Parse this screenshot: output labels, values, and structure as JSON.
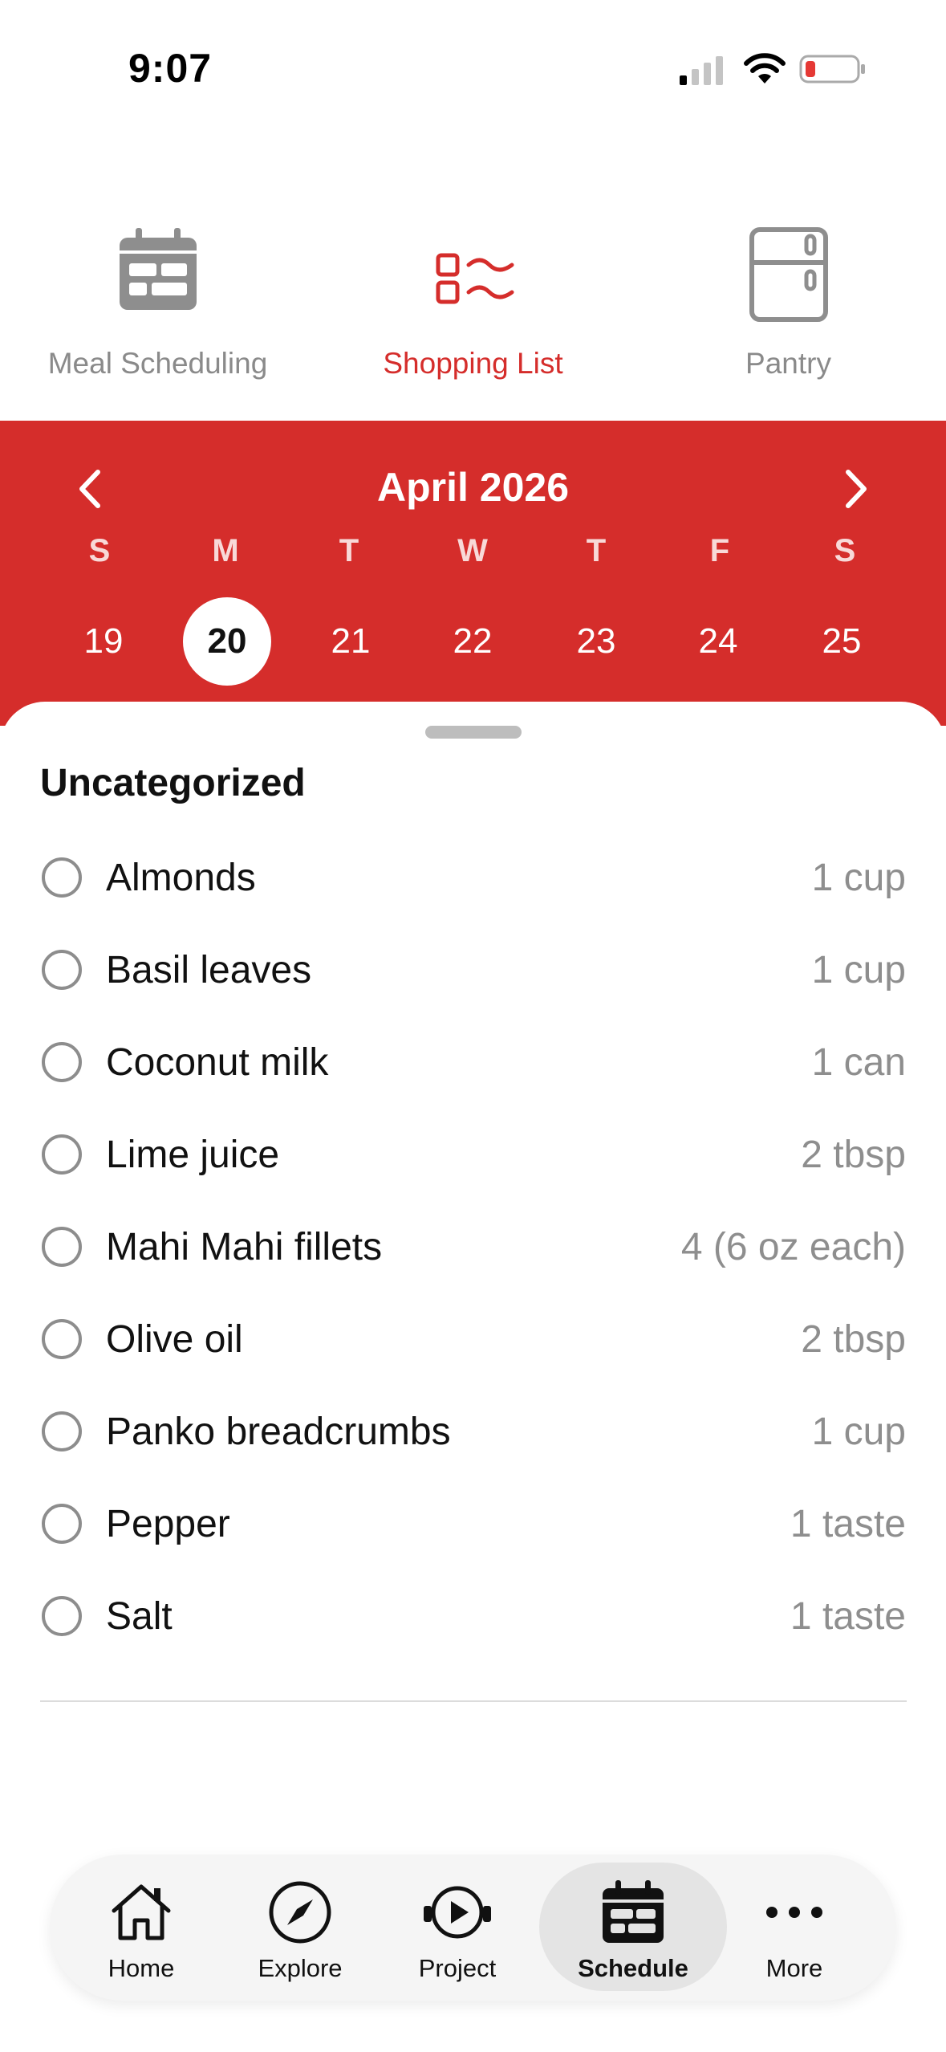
{
  "status_bar": {
    "time": "9:07"
  },
  "top_tabs": [
    {
      "label": "Meal Scheduling",
      "icon": "calendar-icon",
      "active": false
    },
    {
      "label": "Shopping List",
      "icon": "checklist-icon",
      "active": true
    },
    {
      "label": "Pantry",
      "icon": "fridge-icon",
      "active": false
    }
  ],
  "calendar": {
    "title": "April 2026",
    "weekdays": [
      "S",
      "M",
      "T",
      "W",
      "T",
      "F",
      "S"
    ],
    "days": [
      "19",
      "20",
      "21",
      "22",
      "23",
      "24",
      "25"
    ],
    "selected_day": "20",
    "accent_color": "#d52d2b"
  },
  "list": {
    "section_title": "Uncategorized",
    "items": [
      {
        "name": "Almonds",
        "qty": "1 cup"
      },
      {
        "name": "Basil leaves",
        "qty": "1 cup"
      },
      {
        "name": "Coconut milk",
        "qty": "1 can"
      },
      {
        "name": "Lime juice",
        "qty": "2 tbsp"
      },
      {
        "name": "Mahi Mahi fillets",
        "qty": "4 (6 oz each)"
      },
      {
        "name": "Olive oil",
        "qty": "2 tbsp"
      },
      {
        "name": "Panko breadcrumbs",
        "qty": "1 cup"
      },
      {
        "name": "Pepper",
        "qty": "1 taste"
      },
      {
        "name": "Salt",
        "qty": "1 taste"
      }
    ]
  },
  "bottom_nav": [
    {
      "label": "Home",
      "icon": "home-icon"
    },
    {
      "label": "Explore",
      "icon": "compass-icon"
    },
    {
      "label": "Project",
      "icon": "play-icon"
    },
    {
      "label": "Schedule",
      "icon": "calendar-icon",
      "active": true
    },
    {
      "label": "More",
      "icon": "more-icon"
    }
  ]
}
